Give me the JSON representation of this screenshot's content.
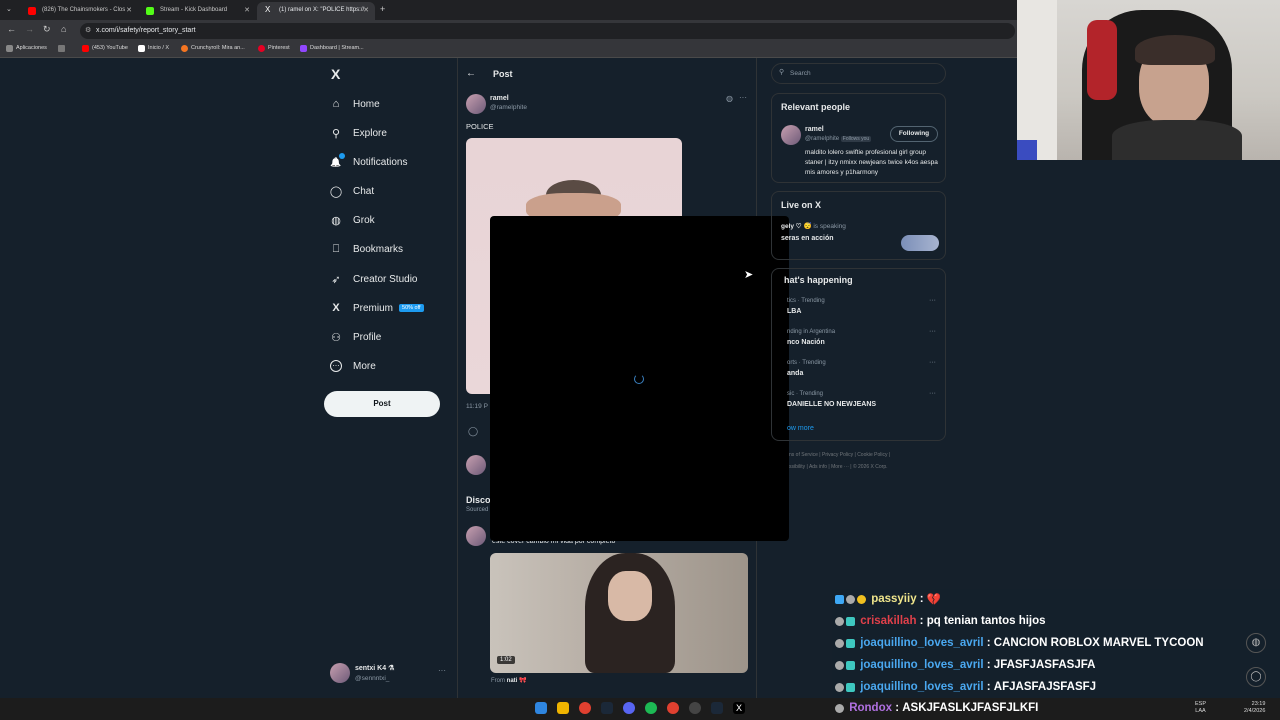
{
  "browser": {
    "tabs": [
      {
        "title": "(826) The Chainsmokers - Clos",
        "color": "#ff0000"
      },
      {
        "title": "Stream - Kick Dashboard",
        "color": "#53fc18"
      },
      {
        "title": "(1) ramel on X: \"POLICE https://",
        "color": "#ffffff"
      }
    ],
    "url": "x.com/i/safety/report_story_start",
    "bookmarks": [
      "Aplicaciones",
      "(453) YouTube",
      "Inicio / X",
      "Crunchyroll: Mira an...",
      "Pinterest",
      "Dashboard | Stream..."
    ]
  },
  "nav": {
    "items": [
      {
        "label": "Home",
        "icon": "⌂"
      },
      {
        "label": "Explore",
        "icon": "⚲"
      },
      {
        "label": "Notifications",
        "icon": "🔔"
      },
      {
        "label": "Chat",
        "icon": "◯"
      },
      {
        "label": "Grok",
        "icon": "◍"
      },
      {
        "label": "Bookmarks",
        "icon": "⎕"
      },
      {
        "label": "Creator Studio",
        "icon": "➶"
      },
      {
        "label": "Premium",
        "icon": "X"
      },
      {
        "label": "Profile",
        "icon": "⚇"
      },
      {
        "label": "More",
        "icon": "⋯"
      }
    ],
    "premium_badge": "50% off",
    "post_button": "Post",
    "account": {
      "name": "sentxi K4 ⚗",
      "handle": "@sennntxi_"
    }
  },
  "main": {
    "header": "Post",
    "author_name": "ramel",
    "author_handle": "@ramelphite",
    "post_text": "POLICE",
    "time_fragment": "11:19 P",
    "discover_fragment": "Disco",
    "sourced_fragment": "Sourced",
    "reply_text": "este cover cambio mi vida por completo",
    "video_duration": "1:02",
    "from_label": "From",
    "from_name": "nati 🎀"
  },
  "right": {
    "search_placeholder": "Search",
    "relevant_title": "Relevant people",
    "relevant_name": "ramel",
    "relevant_handle": "@ramelphite",
    "follows_you": "Follows you",
    "following_btn": "Following",
    "relevant_bio": "maldito lolero swiftie profesional girl group staner | itzy nmixx newjeans twice k4os aespa mis amores y p1harmony",
    "live_title": "Live on X",
    "live_speaker": "gely ♡ 😴",
    "live_status": "is speaking",
    "live_room": "seras en acción",
    "happening_title": "hat's happening",
    "trends": [
      {
        "meta": "tics · Trending",
        "name": "LBA"
      },
      {
        "meta": "nding in Argentina",
        "name": "nco Nación"
      },
      {
        "meta": "orts · Trending",
        "name": "anda"
      },
      {
        "meta": "sic · Trending",
        "name": "DANIELLE NO NEWJEANS"
      }
    ],
    "show_more": "ow more",
    "footer_line1": [
      "ns of Service",
      "Privacy Policy",
      "Cookie Policy"
    ],
    "footer_line2": [
      "ssibility",
      "Ads info",
      "More ···",
      "© 2026 X Corp."
    ]
  },
  "chat": [
    {
      "user": "passyiiy",
      "msg": "💔",
      "color": "#f0e68c"
    },
    {
      "user": "crisakillah",
      "msg": "pq tenian tantos hijos",
      "color": "#e0404a"
    },
    {
      "user": "joaquillino_loves_avril",
      "msg": "CANCION ROBLOX MARVEL TYCOON",
      "color": "#4aa8f0"
    },
    {
      "user": "joaquillino_loves_avril",
      "msg": "JFASFJASFASJFA",
      "color": "#4aa8f0"
    },
    {
      "user": "joaquillino_loves_avril",
      "msg": "AFJASFAJSFASFJ",
      "color": "#4aa8f0"
    },
    {
      "user": "Rondox",
      "msg": "ASKJFASLKJFASFJLKFI",
      "color": "#b070e0"
    }
  ],
  "taskbar": {
    "lang": "ESP",
    "region": "LAA",
    "time": "23:19",
    "date": "2/4/2026"
  },
  "colors": {
    "accent": "#1d9bf0",
    "bg": "#15202b"
  }
}
